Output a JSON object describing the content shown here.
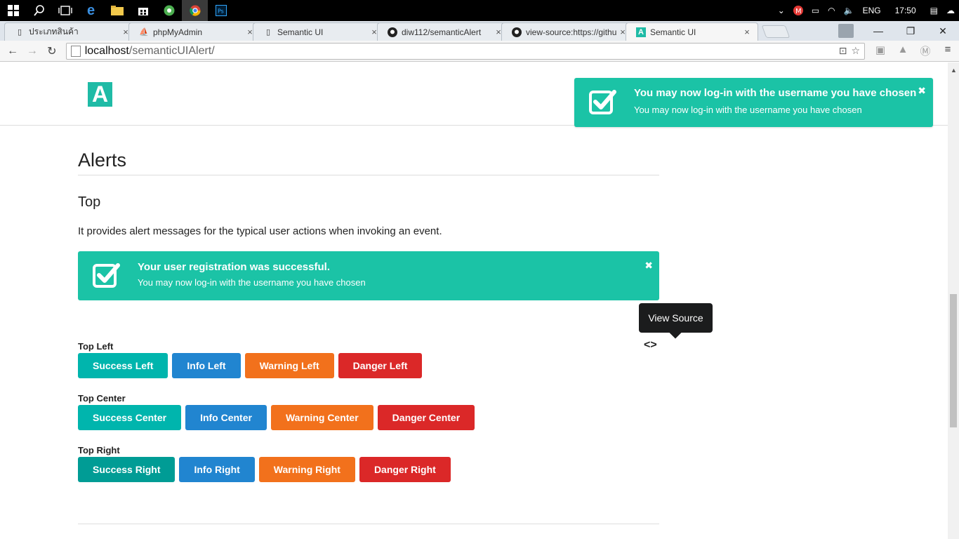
{
  "taskbar": {
    "icons": [
      "windows-start-icon",
      "search-icon",
      "task-view-icon",
      "edge-icon",
      "file-explorer-icon",
      "store-icon",
      "app-icon",
      "chrome-icon",
      "photoshop-icon"
    ],
    "tray": {
      "lang": "ENG",
      "time": "17:50"
    }
  },
  "browser": {
    "tabs": [
      {
        "title": "ประเภทสินค้า"
      },
      {
        "title": "phpMyAdmin"
      },
      {
        "title": "Semantic UI"
      },
      {
        "title": "diw112/semanticAlert"
      },
      {
        "title": "view-source:https://githu"
      },
      {
        "title": "Semantic UI"
      }
    ],
    "url_host": "localhost",
    "url_path": "/semanticUIAlert/"
  },
  "toast": {
    "title": "You may now log-in with the username you have chosen",
    "message": "You may now log-in with the username you have chosen",
    "close": "✖"
  },
  "page": {
    "logo": "A",
    "heading": "Alerts",
    "subheading": "Top",
    "description": "It provides alert messages for the typical user actions when invoking an event.",
    "alert": {
      "title": "Your user registration was successful.",
      "message": "You may now log-in with the username you have chosen",
      "close": "✖"
    },
    "tooltip": "View Source",
    "groups": [
      {
        "label": "Top Left",
        "buttons": [
          "Success Left",
          "Info Left",
          "Warning Left",
          "Danger Left"
        ]
      },
      {
        "label": "Top Center",
        "buttons": [
          "Success Center",
          "Info Center",
          "Warning Center",
          "Danger Center"
        ]
      },
      {
        "label": "Top Right",
        "buttons": [
          "Success Right",
          "Info Right",
          "Warning Right",
          "Danger Right"
        ]
      }
    ]
  },
  "colors": {
    "teal": "#1bc3a6",
    "success": "#00b5ad",
    "info": "#2185d0",
    "warning": "#f2711c",
    "danger": "#db2828"
  }
}
